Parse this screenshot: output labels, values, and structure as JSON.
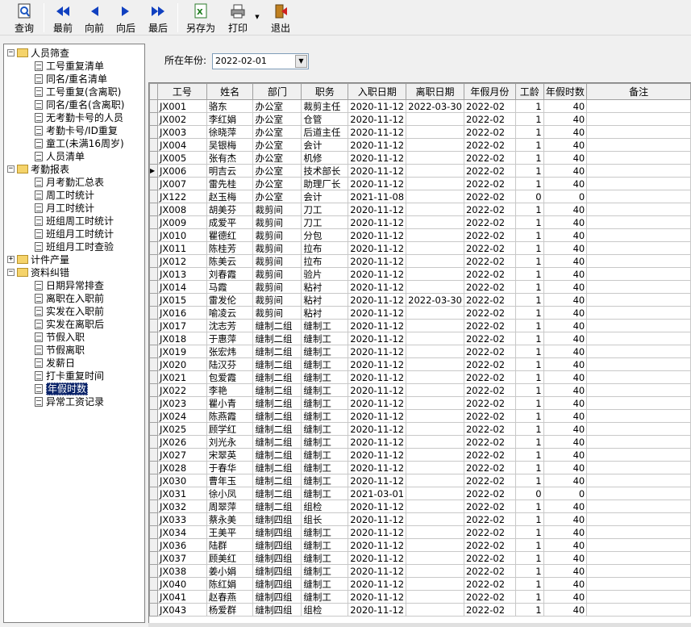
{
  "toolbar": {
    "query": "查询",
    "first": "最前",
    "prev": "向前",
    "next": "向后",
    "last": "最后",
    "saveas": "另存为",
    "print": "打印",
    "exit": "退出"
  },
  "tree": [
    {
      "level": 0,
      "type": "folder",
      "expander": "−",
      "label": "人员筛查"
    },
    {
      "level": 1,
      "type": "doc",
      "label": "工号重复清单"
    },
    {
      "level": 1,
      "type": "doc",
      "label": "同名/重名清单"
    },
    {
      "level": 1,
      "type": "doc",
      "label": "工号重复(含离职)"
    },
    {
      "level": 1,
      "type": "doc",
      "label": "同名/重名(含离职)"
    },
    {
      "level": 1,
      "type": "doc",
      "label": "无考勤卡号的人员"
    },
    {
      "level": 1,
      "type": "doc",
      "label": "考勤卡号/ID重复"
    },
    {
      "level": 1,
      "type": "doc",
      "label": "童工(未满16周岁)"
    },
    {
      "level": 1,
      "type": "doc",
      "label": "人员清单"
    },
    {
      "level": 0,
      "type": "folder",
      "expander": "−",
      "label": "考勤报表"
    },
    {
      "level": 1,
      "type": "doc",
      "label": "月考勤汇总表"
    },
    {
      "level": 1,
      "type": "doc",
      "label": "周工时统计"
    },
    {
      "level": 1,
      "type": "doc",
      "label": "月工时统计"
    },
    {
      "level": 1,
      "type": "doc",
      "label": "班组周工时统计"
    },
    {
      "level": 1,
      "type": "doc",
      "label": "班组月工时统计"
    },
    {
      "level": 1,
      "type": "doc",
      "label": "班组月工时查验"
    },
    {
      "level": 0,
      "type": "folder",
      "expander": "+",
      "label": "计件产量"
    },
    {
      "level": 0,
      "type": "folder",
      "expander": "−",
      "label": "资料纠错"
    },
    {
      "level": 1,
      "type": "doc",
      "label": "日期异常排查"
    },
    {
      "level": 1,
      "type": "doc",
      "label": "离职在入职前"
    },
    {
      "level": 1,
      "type": "doc",
      "label": "实发在入职前"
    },
    {
      "level": 1,
      "type": "doc",
      "label": "实发在离职后"
    },
    {
      "level": 1,
      "type": "doc",
      "label": "节假入职"
    },
    {
      "level": 1,
      "type": "doc",
      "label": "节假离职"
    },
    {
      "level": 1,
      "type": "doc",
      "label": "发薪日"
    },
    {
      "level": 1,
      "type": "doc",
      "label": "打卡重复时间"
    },
    {
      "level": 1,
      "type": "doc",
      "label": "年假时数",
      "selected": true
    },
    {
      "level": 1,
      "type": "doc",
      "label": "异常工资记录"
    }
  ],
  "filter": {
    "label": "所在年份:",
    "value": "2022-02-01"
  },
  "columns": [
    "工号",
    "姓名",
    "部门",
    "职务",
    "入职日期",
    "离职日期",
    "年假月份",
    "工龄",
    "年假时数",
    "备注"
  ],
  "current_row": 5,
  "rows": [
    [
      "JX001",
      "骆东",
      "办公室",
      "裁剪主任",
      "2020-11-12",
      "2022-03-30",
      "2022-02",
      "1",
      "40",
      ""
    ],
    [
      "JX002",
      "李红娟",
      "办公室",
      "仓管",
      "2020-11-12",
      "",
      "2022-02",
      "1",
      "40",
      ""
    ],
    [
      "JX003",
      "徐晓萍",
      "办公室",
      "后道主任",
      "2020-11-12",
      "",
      "2022-02",
      "1",
      "40",
      ""
    ],
    [
      "JX004",
      "吴银梅",
      "办公室",
      "会计",
      "2020-11-12",
      "",
      "2022-02",
      "1",
      "40",
      ""
    ],
    [
      "JX005",
      "张有杰",
      "办公室",
      "机修",
      "2020-11-12",
      "",
      "2022-02",
      "1",
      "40",
      ""
    ],
    [
      "JX006",
      "明吉云",
      "办公室",
      "技术部长",
      "2020-11-12",
      "",
      "2022-02",
      "1",
      "40",
      ""
    ],
    [
      "JX007",
      "雷先桂",
      "办公室",
      "助理厂长",
      "2020-11-12",
      "",
      "2022-02",
      "1",
      "40",
      ""
    ],
    [
      "JX122",
      "赵玉梅",
      "办公室",
      "会计",
      "2021-11-08",
      "",
      "2022-02",
      "0",
      "0",
      ""
    ],
    [
      "JX008",
      "胡美芬",
      "裁剪间",
      "刀工",
      "2020-11-12",
      "",
      "2022-02",
      "1",
      "40",
      ""
    ],
    [
      "JX009",
      "成爱平",
      "裁剪间",
      "刀工",
      "2020-11-12",
      "",
      "2022-02",
      "1",
      "40",
      ""
    ],
    [
      "JX010",
      "瞿德红",
      "裁剪间",
      "分包",
      "2020-11-12",
      "",
      "2022-02",
      "1",
      "40",
      ""
    ],
    [
      "JX011",
      "陈桂芳",
      "裁剪间",
      "拉布",
      "2020-11-12",
      "",
      "2022-02",
      "1",
      "40",
      ""
    ],
    [
      "JX012",
      "陈美云",
      "裁剪间",
      "拉布",
      "2020-11-12",
      "",
      "2022-02",
      "1",
      "40",
      ""
    ],
    [
      "JX013",
      "刘春霞",
      "裁剪间",
      "验片",
      "2020-11-12",
      "",
      "2022-02",
      "1",
      "40",
      ""
    ],
    [
      "JX014",
      "马霞",
      "裁剪间",
      "粘衬",
      "2020-11-12",
      "",
      "2022-02",
      "1",
      "40",
      ""
    ],
    [
      "JX015",
      "雷发伦",
      "裁剪间",
      "粘衬",
      "2020-11-12",
      "2022-03-30",
      "2022-02",
      "1",
      "40",
      ""
    ],
    [
      "JX016",
      "喻凌云",
      "裁剪间",
      "粘衬",
      "2020-11-12",
      "",
      "2022-02",
      "1",
      "40",
      ""
    ],
    [
      "JX017",
      "沈志芳",
      "缝制二组",
      "缝制工",
      "2020-11-12",
      "",
      "2022-02",
      "1",
      "40",
      ""
    ],
    [
      "JX018",
      "于惠萍",
      "缝制二组",
      "缝制工",
      "2020-11-12",
      "",
      "2022-02",
      "1",
      "40",
      ""
    ],
    [
      "JX019",
      "张宏炜",
      "缝制二组",
      "缝制工",
      "2020-11-12",
      "",
      "2022-02",
      "1",
      "40",
      ""
    ],
    [
      "JX020",
      "陆汉芬",
      "缝制二组",
      "缝制工",
      "2020-11-12",
      "",
      "2022-02",
      "1",
      "40",
      ""
    ],
    [
      "JX021",
      "包爱霞",
      "缝制二组",
      "缝制工",
      "2020-11-12",
      "",
      "2022-02",
      "1",
      "40",
      ""
    ],
    [
      "JX022",
      "李艳",
      "缝制二组",
      "缝制工",
      "2020-11-12",
      "",
      "2022-02",
      "1",
      "40",
      ""
    ],
    [
      "JX023",
      "瞿小青",
      "缝制二组",
      "缝制工",
      "2020-11-12",
      "",
      "2022-02",
      "1",
      "40",
      ""
    ],
    [
      "JX024",
      "陈燕霞",
      "缝制二组",
      "缝制工",
      "2020-11-12",
      "",
      "2022-02",
      "1",
      "40",
      ""
    ],
    [
      "JX025",
      "顾学红",
      "缝制二组",
      "缝制工",
      "2020-11-12",
      "",
      "2022-02",
      "1",
      "40",
      ""
    ],
    [
      "JX026",
      "刘光永",
      "缝制二组",
      "缝制工",
      "2020-11-12",
      "",
      "2022-02",
      "1",
      "40",
      ""
    ],
    [
      "JX027",
      "宋翠英",
      "缝制二组",
      "缝制工",
      "2020-11-12",
      "",
      "2022-02",
      "1",
      "40",
      ""
    ],
    [
      "JX028",
      "于春华",
      "缝制二组",
      "缝制工",
      "2020-11-12",
      "",
      "2022-02",
      "1",
      "40",
      ""
    ],
    [
      "JX030",
      "曹年玉",
      "缝制二组",
      "缝制工",
      "2020-11-12",
      "",
      "2022-02",
      "1",
      "40",
      ""
    ],
    [
      "JX031",
      "徐小凤",
      "缝制二组",
      "缝制工",
      "2021-03-01",
      "",
      "2022-02",
      "0",
      "0",
      ""
    ],
    [
      "JX032",
      "周翠萍",
      "缝制二组",
      "组检",
      "2020-11-12",
      "",
      "2022-02",
      "1",
      "40",
      ""
    ],
    [
      "JX033",
      "蔡永美",
      "缝制四组",
      "组长",
      "2020-11-12",
      "",
      "2022-02",
      "1",
      "40",
      ""
    ],
    [
      "JX034",
      "王美平",
      "缝制四组",
      "缝制工",
      "2020-11-12",
      "",
      "2022-02",
      "1",
      "40",
      ""
    ],
    [
      "JX036",
      "陆群",
      "缝制四组",
      "缝制工",
      "2020-11-12",
      "",
      "2022-02",
      "1",
      "40",
      ""
    ],
    [
      "JX037",
      "顾美红",
      "缝制四组",
      "缝制工",
      "2020-11-12",
      "",
      "2022-02",
      "1",
      "40",
      ""
    ],
    [
      "JX038",
      "姜小娟",
      "缝制四组",
      "缝制工",
      "2020-11-12",
      "",
      "2022-02",
      "1",
      "40",
      ""
    ],
    [
      "JX040",
      "陈红娟",
      "缝制四组",
      "缝制工",
      "2020-11-12",
      "",
      "2022-02",
      "1",
      "40",
      ""
    ],
    [
      "JX041",
      "赵春燕",
      "缝制四组",
      "缝制工",
      "2020-11-12",
      "",
      "2022-02",
      "1",
      "40",
      ""
    ],
    [
      "JX043",
      "杨爱群",
      "缝制四组",
      "组检",
      "2020-11-12",
      "",
      "2022-02",
      "1",
      "40",
      ""
    ]
  ]
}
